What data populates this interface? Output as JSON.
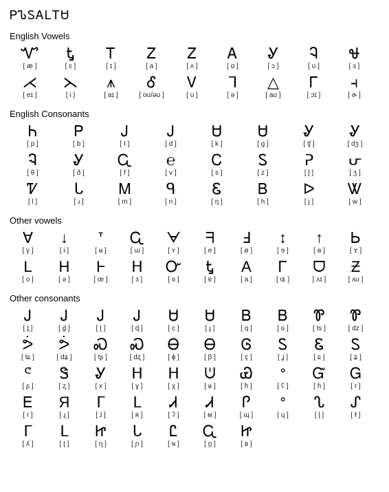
{
  "title": "ᏢᏖᏚᎪᏞᎢᏌ",
  "sections": [
    {
      "title": "English Vowels",
      "col_count": 9,
      "rows": [
        [
          {
            "glyph": "Ꮙ",
            "ipa": "[ æ ]"
          },
          {
            "glyph": "Ꮏ",
            "ipa": "[ ɛ ]"
          },
          {
            "glyph": "Ꭲ",
            "ipa": "[ ɪ ]"
          },
          {
            "glyph": "Ꮓ",
            "ipa": "[ a ]"
          },
          {
            "glyph": "Ꮓ",
            "ipa": "[ ʌ ]"
          },
          {
            "glyph": "Ꭺ",
            "ipa": "[ ɑ ]"
          },
          {
            "glyph": "Ꮍ",
            "ipa": "[ ɔ ]"
          },
          {
            "glyph": "Ꮈ",
            "ipa": "[ ʊ ]"
          },
          {
            "glyph": "Ꮰ",
            "ipa": "[ ɜ ]"
          }
        ],
        [
          {
            "glyph": "⋌",
            "ipa": "[ eɪ ]"
          },
          {
            "glyph": "⋋",
            "ipa": "[ i ]"
          },
          {
            "glyph": "⩚",
            "ipa": "[ aɪ ]"
          },
          {
            "glyph": "Ꮄ",
            "ipa": "[ oʊ/əʊ ]"
          },
          {
            "glyph": "Ꮩ",
            "ipa": "[ u ]"
          },
          {
            "gly�": "",
            "glyph": "ᒣ",
            "ipa": "[ ə ]"
          },
          {
            "glyph": "△",
            "ipa": "[ aʊ ]"
          },
          {
            "glyph": "Ꮁ",
            "ipa": "[ ɔɪ ]"
          },
          {
            "glyph": "⫞",
            "ipa": "[ ɚ ]"
          }
        ]
      ]
    },
    {
      "title": "English Consonants",
      "col_count": 8,
      "rows": [
        [
          {
            "glyph": "Ꮒ",
            "ipa": "[ p ]"
          },
          {
            "glyph": "Ꮲ",
            "ipa": "[ b ]"
          },
          {
            "glyph": "Ꭻ",
            "ipa": "[ t ]"
          },
          {
            "glyph": "Ꭻ",
            "ipa": "[ d ]"
          },
          {
            "glyph": "Ꮜ",
            "ipa": "[ k ]"
          },
          {
            "glyph": "Ꮜ",
            "ipa": "[ g ]"
          },
          {
            "glyph": "Ꮍ",
            "ipa": "[ tʃ ]"
          },
          {
            "glyph": "Ꮍ",
            "ipa": "[ dʒ ]"
          }
        ],
        [
          {
            "glyph": "Ꮈ",
            "ipa": "[ θ ]"
          },
          {
            "glyph": "Ꮍ",
            "ipa": "[ ð ]"
          },
          {
            "glyph": "Ꮹ",
            "ipa": "[ f ]"
          },
          {
            "glyph": "℮",
            "ipa": "[ v ]"
          },
          {
            "glyph": "Ꮯ",
            "ipa": "[ s ]"
          },
          {
            "glyph": "Ꮪ",
            "ipa": "[ z ]"
          },
          {
            "glyph": "ᕈ",
            "ipa": "[ ʃ ]"
          },
          {
            "glyph": "ᕂ",
            "ipa": "[ ʒ ]"
          }
        ],
        [
          {
            "glyph": "Ꮴ",
            "ipa": "[ l ]"
          },
          {
            "glyph": "ᒐ",
            "ipa": "[ ɹ ]"
          },
          {
            "glyph": "Ꮇ",
            "ipa": "[ m ]"
          },
          {
            "glyph": "ᑫ",
            "ipa": "[ n ]"
          },
          {
            "glyph": "Ꮛ",
            "ipa": "[ ŋ ]"
          },
          {
            "glyph": "Ᏼ",
            "ipa": "[ h ]"
          },
          {
            "glyph": "ᐅ",
            "ipa": "[ j ]"
          },
          {
            "glyph": "Ꮤ",
            "ipa": "[ w ]"
          }
        ]
      ]
    },
    {
      "title": "Other vowels",
      "col_count": 10,
      "rows": [
        [
          {
            "glyph": "∀",
            "ipa": "[ y ]"
          },
          {
            "glyph": "↓",
            "ipa": "[ ɨ ]"
          },
          {
            "glyph": "ᐪ",
            "ipa": "[ ʉ ]"
          },
          {
            "glyph": "Ꮹ",
            "ipa": "[ ɯ ]"
          },
          {
            "glyph": "ᗄ",
            "ipa": "[ ʏ ]"
          },
          {
            "glyph": "ᖷ",
            "ipa": "[ e ]"
          },
          {
            "glyph": "Ⅎ",
            "ipa": "[ ø ]"
          },
          {
            "glyph": "↕",
            "ipa": "[ ɘ ]"
          },
          {
            "glyph": "↑",
            "ipa": "[ ɵ ]"
          },
          {
            "glyph": "Ꮟ",
            "ipa": "[ ɤ ]"
          }
        ],
        [
          {
            "glyph": "L",
            "ipa": "[ o ]"
          },
          {
            "glyph": "H",
            "ipa": "[ ə ]"
          },
          {
            "glyph": "Ⱶ",
            "ipa": "[ œ ]"
          },
          {
            "glyph": "ᕼ",
            "ipa": "[ ɜ ]"
          },
          {
            "glyph": "Ꮕ",
            "ipa": "[ ɞ ]"
          },
          {
            "glyph": "Ꮏ",
            "ipa": "[ ɐ ]"
          },
          {
            "glyph": "A",
            "ipa": "[ a ]"
          },
          {
            "glyph": "Ꮁ",
            "ipa": "[ ɶ ]"
          },
          {
            "glyph": "ᗜ",
            "ipa": "[ ʌɪ ]"
          },
          {
            "glyph": "Ƶ",
            "ipa": "[ ʌʊ ]"
          }
        ]
      ]
    },
    {
      "title": "Other consonants",
      "col_count": 10,
      "rows": [
        [
          {
            "glyph": "Ꭻ",
            "ipa": "[ t̪ ]"
          },
          {
            "glyph": "Ꭻ",
            "ipa": "[ d̪ ]"
          },
          {
            "glyph": "Ꭻ",
            "ipa": "[ ʈ ]"
          },
          {
            "glyph": "Ꭻ",
            "ipa": "[ ɖ ]"
          },
          {
            "glyph": "Ꮜ",
            "ipa": "[ c ]"
          },
          {
            "glyph": "Ꮜ",
            "ipa": "[ ɟ ]"
          },
          {
            "glyph": "Ᏼ",
            "ipa": "[ q ]"
          },
          {
            "glyph": "Ᏼ",
            "ipa": "[ ɢ ]"
          },
          {
            "glyph": "Ꮘ",
            "ipa": "[ ts ]"
          },
          {
            "glyph": "Ꮘ",
            "ipa": "[ dz ]"
          }
        ],
        [
          {
            "glyph": "ᕘ",
            "ipa": "[ tɕ ]"
          },
          {
            "glyph": "ᕘ",
            "ipa": "[ dʑ ]"
          },
          {
            "glyph": "Ꮝ",
            "ipa": "[ tʂ ]"
          },
          {
            "glyph": "Ꮝ",
            "ipa": "[ dʐ ]"
          },
          {
            "glyph": "Ꮎ",
            "ipa": "[ ɸ ]"
          },
          {
            "glyph": "Ꮎ",
            "ipa": "[ β ]"
          },
          {
            "glyph": "Ꮆ",
            "ipa": "[ ç ]"
          },
          {
            "glyph": "Ꮪ",
            "ipa": "[ ʝ ]"
          },
          {
            "glyph": "Ꮛ",
            "ipa": "[ ɕ ]"
          },
          {
            "glyph": "Ꮪ",
            "ipa": "[ ʑ ]"
          }
        ],
        [
          {
            "glyph": "ᕪ",
            "ipa": "[ ʂ ]"
          },
          {
            "glyph": "Ꮥ",
            "ipa": "[ ʐ ]"
          },
          {
            "glyph": "Ꮍ",
            "ipa": "[ x ]"
          },
          {
            "glyph": "ᕼ",
            "ipa": "[ ɣ ]"
          },
          {
            "glyph": "ᕼ",
            "ipa": "[ χ ]"
          },
          {
            "glyph": "ᕫ",
            "ipa": "[ ʁ ]"
          },
          {
            "glyph": "Ꮿ",
            "ipa": "[ ħ ]"
          },
          {
            "glyph": "ᐤ",
            "ipa": "[ ʕ ]"
          },
          {
            "glyph": "Ᏻ",
            "ipa": "[ ɦ ]"
          },
          {
            "glyph": "Ꮐ",
            "ipa": "[ r ]"
          }
        ],
        [
          {
            "glyph": "Ꭼ",
            "ipa": "[ ɾ ]"
          },
          {
            "glyph": "Я",
            "ipa": "[ ɻ ]"
          },
          {
            "glyph": "ᒥ",
            "ipa": "[ ɺ ]"
          },
          {
            "glyph": "ᒪ",
            "ipa": "[ ʀ ]"
          },
          {
            "glyph": "Ꮧ",
            "ipa": "[ ʔ ]"
          },
          {
            "glyph": "Ꮧ",
            "ipa": "[ ᴍ ]"
          },
          {
            "glyph": "Ꮅ",
            "ipa": "[ ɰ ]"
          },
          {
            "glyph": "ᐤ",
            "ipa": "[ ɥ ]"
          },
          {
            "glyph": "ᔐ",
            "ipa": "[ ɭ ]"
          },
          {
            "glyph": "ᔑ",
            "ipa": "[ ɬ ]"
          }
        ],
        [
          {
            "glyph": "ᒥ",
            "ipa": "[ ʎ ]"
          },
          {
            "glyph": "ᒪ",
            "ipa": "[ ʈ ]"
          },
          {
            "glyph": "Ꮵ",
            "ipa": "[ ɳ ]"
          },
          {
            "glyph": "ᒐ",
            "ipa": "[ ɲ ]"
          },
          {
            "glyph": "Ꮭ",
            "ipa": "[ ɴ ]"
          },
          {
            "glyph": "Ꮹ",
            "ipa": "[ n̪ ]"
          },
          {
            "glyph": "Ꮵ",
            "ipa": "[ ʙ ]"
          }
        ]
      ]
    }
  ]
}
